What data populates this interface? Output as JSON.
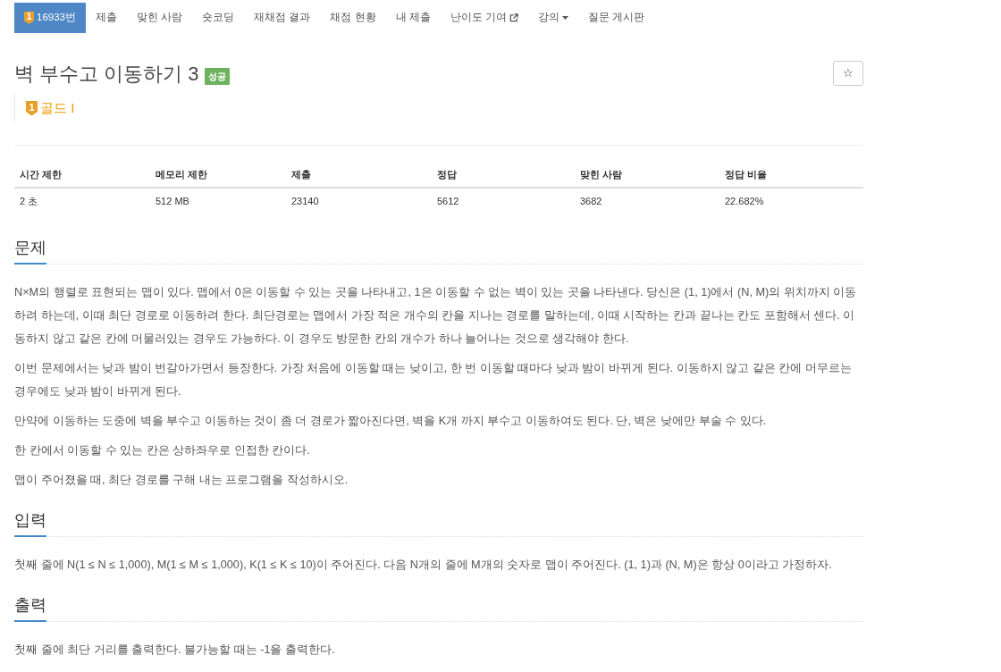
{
  "nav": {
    "tabs": [
      {
        "label": "16933번",
        "kind": "tier",
        "badge": "1",
        "selected": true
      },
      {
        "label": "제출",
        "kind": "plain",
        "selected": false
      },
      {
        "label": "맞힌 사람",
        "kind": "plain",
        "selected": false
      },
      {
        "label": "숏코딩",
        "kind": "plain",
        "selected": false
      },
      {
        "label": "재채점 결과",
        "kind": "plain",
        "selected": false
      },
      {
        "label": "채점 현황",
        "kind": "plain",
        "selected": false
      },
      {
        "label": "내 제출",
        "kind": "plain",
        "selected": false
      },
      {
        "label": "난이도 기여",
        "kind": "external",
        "selected": false
      },
      {
        "label": "강의",
        "kind": "dropdown",
        "selected": false
      },
      {
        "label": "질문 게시판",
        "kind": "plain",
        "selected": false
      }
    ]
  },
  "problem": {
    "title": "벽 부수고 이동하기 3",
    "result_badge": "성공",
    "star_button": "☆",
    "tier": {
      "badge": "1",
      "label": "골드 I"
    }
  },
  "stats_table": {
    "columns": [
      "시간 제한",
      "메모리 제한",
      "제출",
      "정답",
      "맞힌 사람",
      "정답 비율"
    ],
    "rows": [
      [
        "2 초",
        "512 MB",
        "23140",
        "5612",
        "3682",
        "22.682%"
      ]
    ]
  },
  "sections": [
    {
      "heading": "문제",
      "paragraphs": [
        "N×M의 행렬로 표현되는 맵이 있다. 맵에서 0은 이동할 수 있는 곳을 나타내고, 1은 이동할 수 없는 벽이 있는 곳을 나타낸다. 당신은 (1, 1)에서 (N, M)의 위치까지 이동하려 하는데, 이때 최단 경로로 이동하려 한다. 최단경로는 맵에서 가장 적은 개수의 칸을 지나는 경로를 말하는데, 이때 시작하는 칸과 끝나는 칸도 포함해서 센다. 이동하지 않고 같은 칸에 머물러있는 경우도 가능하다. 이 경우도 방문한 칸의 개수가 하나 늘어나는 것으로 생각해야 한다.",
        "이번 문제에서는 낮과 밤이 번갈아가면서 등장한다. 가장 처음에 이동할 때는 낮이고, 한 번 이동할 때마다 낮과 밤이 바뀌게 된다. 이동하지 않고 같은 칸에 머무르는 경우에도 낮과 밤이 바뀌게 된다.",
        "만약에 이동하는 도중에 벽을 부수고 이동하는 것이 좀 더 경로가 짧아진다면, 벽을 K개 까지 부수고 이동하여도 된다. 단, 벽은 낮에만 부술 수 있다.",
        "한 칸에서 이동할 수 있는 칸은 상하좌우로 인접한 칸이다.",
        "맵이 주어졌을 때, 최단 경로를 구해 내는 프로그램을 작성하시오."
      ]
    },
    {
      "heading": "입력",
      "paragraphs": [
        "첫째 줄에 N(1 ≤ N ≤ 1,000), M(1 ≤ M ≤ 1,000), K(1 ≤ K ≤ 10)이 주어진다. 다음 N개의 줄에 M개의 숫자로 맵이 주어진다. (1, 1)과 (N, M)은 항상 0이라고 가정하자."
      ]
    },
    {
      "heading": "출력",
      "paragraphs": [
        "첫째 줄에 최단 거리를 출력한다. 불가능할 때는 -1을 출력한다."
      ]
    }
  ]
}
